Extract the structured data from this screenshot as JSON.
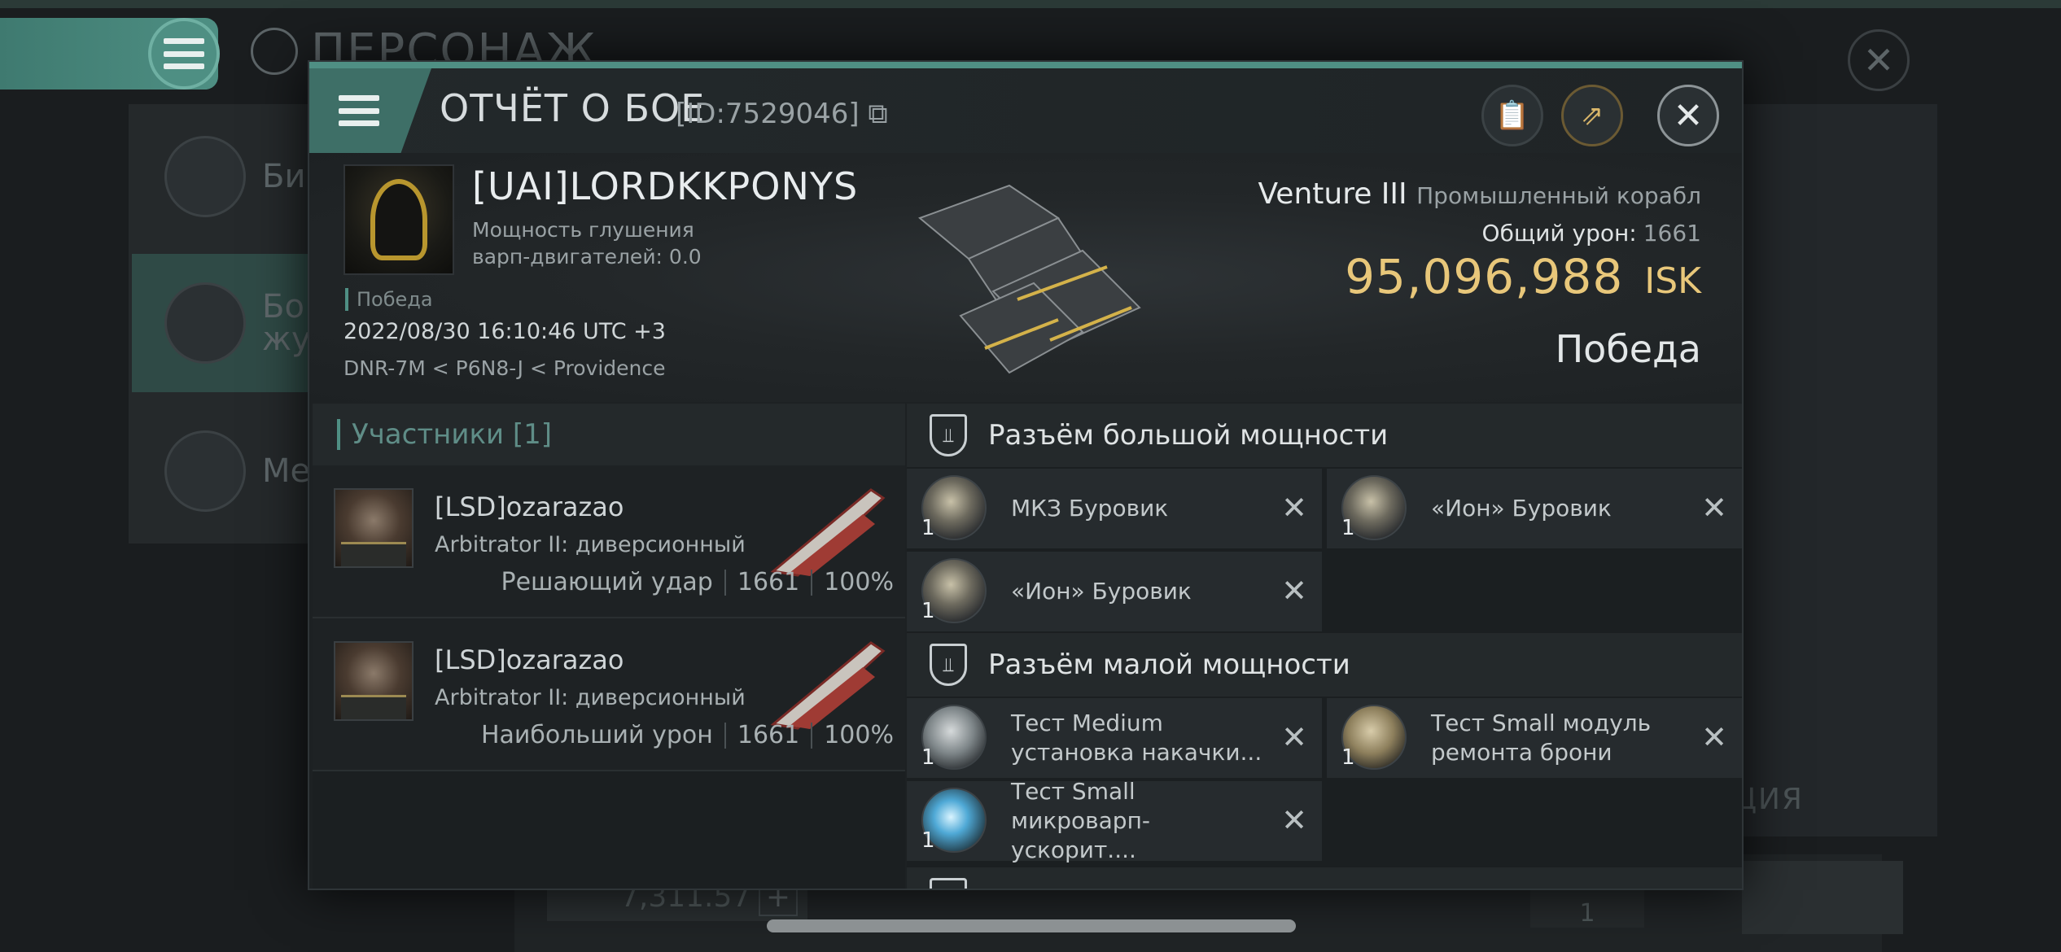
{
  "background": {
    "title": "ПЕРСОНАЖ",
    "left_items": [
      "Би",
      "Бо\nжу",
      "Ме"
    ],
    "ghost_text": "ЦИЯ",
    "bottom_value": "7,311.57",
    "counter": "1"
  },
  "report": {
    "title": "ОТЧЁТ О БОЕ",
    "id": "[ID:7529046]"
  },
  "victim": {
    "name": "[UAI]LORDKKPONYS",
    "warp_label": "Мощность глушения варп-двигателей: 0.0",
    "result": "Победа",
    "datetime": "2022/08/30 16:10:46 UTC +3",
    "location": "DNR-7M < P6N8-J < Providence",
    "ship": "Venture III",
    "ship_class": "Промышленный корабл",
    "total_damage_label": "Общий урон:",
    "total_damage": "1661",
    "isk_value": "95,096,988",
    "isk_currency": "ISK",
    "outcome": "Победа"
  },
  "participants": {
    "header": "Участники [1]",
    "rows": [
      {
        "name": "[LSD]ozarazao",
        "ship": "Arbitrator II: диверсионный",
        "role": "Решающий удар",
        "damage": "1661",
        "percent": "100%"
      },
      {
        "name": "[LSD]ozarazao",
        "ship": "Arbitrator II: диверсионный",
        "role": "Наибольший урон",
        "damage": "1661",
        "percent": "100%"
      }
    ]
  },
  "fitting": {
    "high_slot_title": "Разъём большой мощности",
    "low_slot_title": "Разъём малой мощности",
    "high_modules": [
      {
        "name": "МКЗ Буровик",
        "qty": "1"
      },
      {
        "name": "«Ион» Буровик",
        "qty": "1"
      },
      {
        "name": "«Ион» Буровик",
        "qty": "1"
      }
    ],
    "low_modules": [
      {
        "name": "Тест Medium установка накачки...",
        "qty": "1"
      },
      {
        "name": "Тест Small модуль ремонта брони",
        "qty": "1"
      },
      {
        "name": "Тест Small микроварп-ускорит....",
        "qty": "1"
      }
    ]
  },
  "colors": {
    "accent": "#4f8f84",
    "isk": "#e8c77a"
  }
}
